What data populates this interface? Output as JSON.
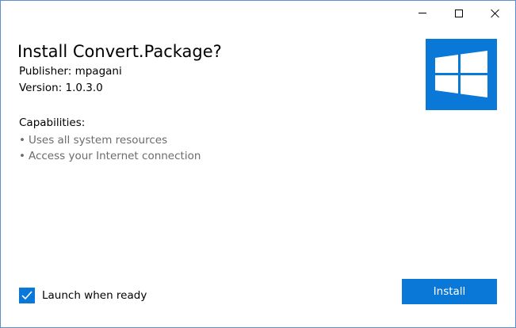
{
  "window_controls": {
    "minimize_icon": "minimize-icon",
    "maximize_icon": "maximize-icon",
    "close_icon": "close-icon"
  },
  "installer": {
    "title": "Install Convert.Package?",
    "publisher": "Publisher: mpagani",
    "version": "Version: 1.0.3.0",
    "capabilities_heading": "Capabilities:",
    "capabilities": [
      "Uses all system resources",
      "Access your Internet connection"
    ],
    "bullet": "•",
    "tile_icon": "windows-logo-icon"
  },
  "footer": {
    "launch_checkbox_label": "Launch when ready",
    "launch_checked": true,
    "install_label": "Install"
  },
  "colors": {
    "accent": "#0a78d7",
    "border": "#5a8fd0",
    "secondary_text": "#6b6b6b"
  }
}
